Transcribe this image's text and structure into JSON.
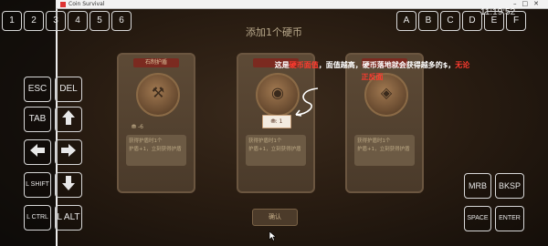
{
  "window": {
    "app_title": "Coin Survival"
  },
  "status": {
    "time": "11:19:52"
  },
  "num_keys": [
    "1",
    "2",
    "3",
    "4",
    "5",
    "6"
  ],
  "letter_keys": [
    "A",
    "B",
    "C",
    "D",
    "E",
    "F"
  ],
  "left_keys": {
    "esc": "ESC",
    "del": "DEL",
    "tab": "TAB",
    "lshift": "L SHIFT",
    "lctrl": "L CTRL",
    "lalt": "L ALT"
  },
  "right_keys": {
    "mrb": "MRB",
    "bksp": "BKSP",
    "space": "SPACE",
    "enter": "ENTER"
  },
  "arrow_icons": [
    "arrow-up-icon",
    "arrow-left-icon",
    "arrow-right-icon",
    "arrow-down-icon"
  ],
  "game": {
    "title": "添加1个硬币",
    "cards": [
      {
        "label": "石制护盾",
        "value": "-6",
        "desc_line1": "获得护盾时1个",
        "desc_line2": "护盾+1，立刻获得护盾"
      },
      {
        "label": "",
        "value": "1",
        "desc_line1": "获得护盾时1个",
        "desc_line2": "护盾+1，立刻获得护盾"
      },
      {
        "label": "",
        "value": "",
        "desc_line1": "获得护盾时1个",
        "desc_line2": "护盾+1，立刻获得护盾"
      }
    ],
    "tooltip_prefix": "这是",
    "tooltip_red1": "硬币面值",
    "tooltip_mid": "，面值越高，硬币落地就会获得越多的$，",
    "tooltip_red2": "无论正反面",
    "coin_badge": "1",
    "confirm": "确认"
  }
}
